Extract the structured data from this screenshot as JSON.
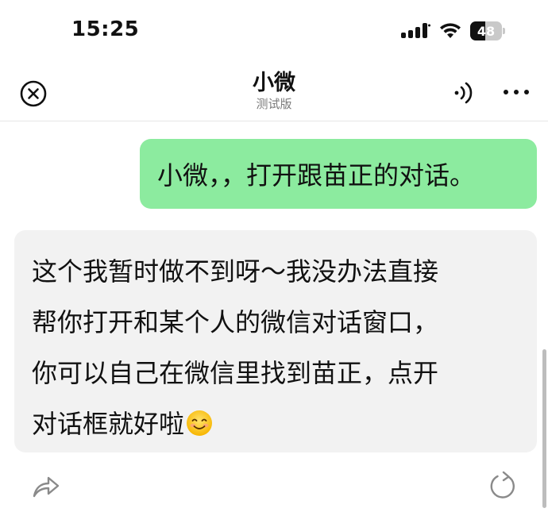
{
  "status_bar": {
    "time": "15:25",
    "battery_level": "48",
    "battery_fraction": 0.48,
    "icons": [
      "signal-icon",
      "wifi-icon",
      "battery-icon"
    ]
  },
  "header": {
    "title": "小微",
    "subtitle": "测试版",
    "icons": [
      "close-icon",
      "voice-icon",
      "more-icon"
    ]
  },
  "chat": {
    "user_message": "小微，，打开跟苗正的对话。",
    "bot_message_lines": [
      "这个我暂时做不到呀～我没办法直接",
      "帮你打开和某个人的微信对话窗口，",
      "你可以自己在微信里找到苗正，点开",
      "对话框就好啦"
    ],
    "bot_emoji": "smiling-face-icon"
  },
  "actions": {
    "icons": [
      "share-icon",
      "refresh-icon"
    ]
  },
  "colors": {
    "user_bubble": "#8ceb9f",
    "bot_bubble": "#f2f2f2",
    "text": "#111111",
    "subtitle": "#7a7a7a"
  }
}
